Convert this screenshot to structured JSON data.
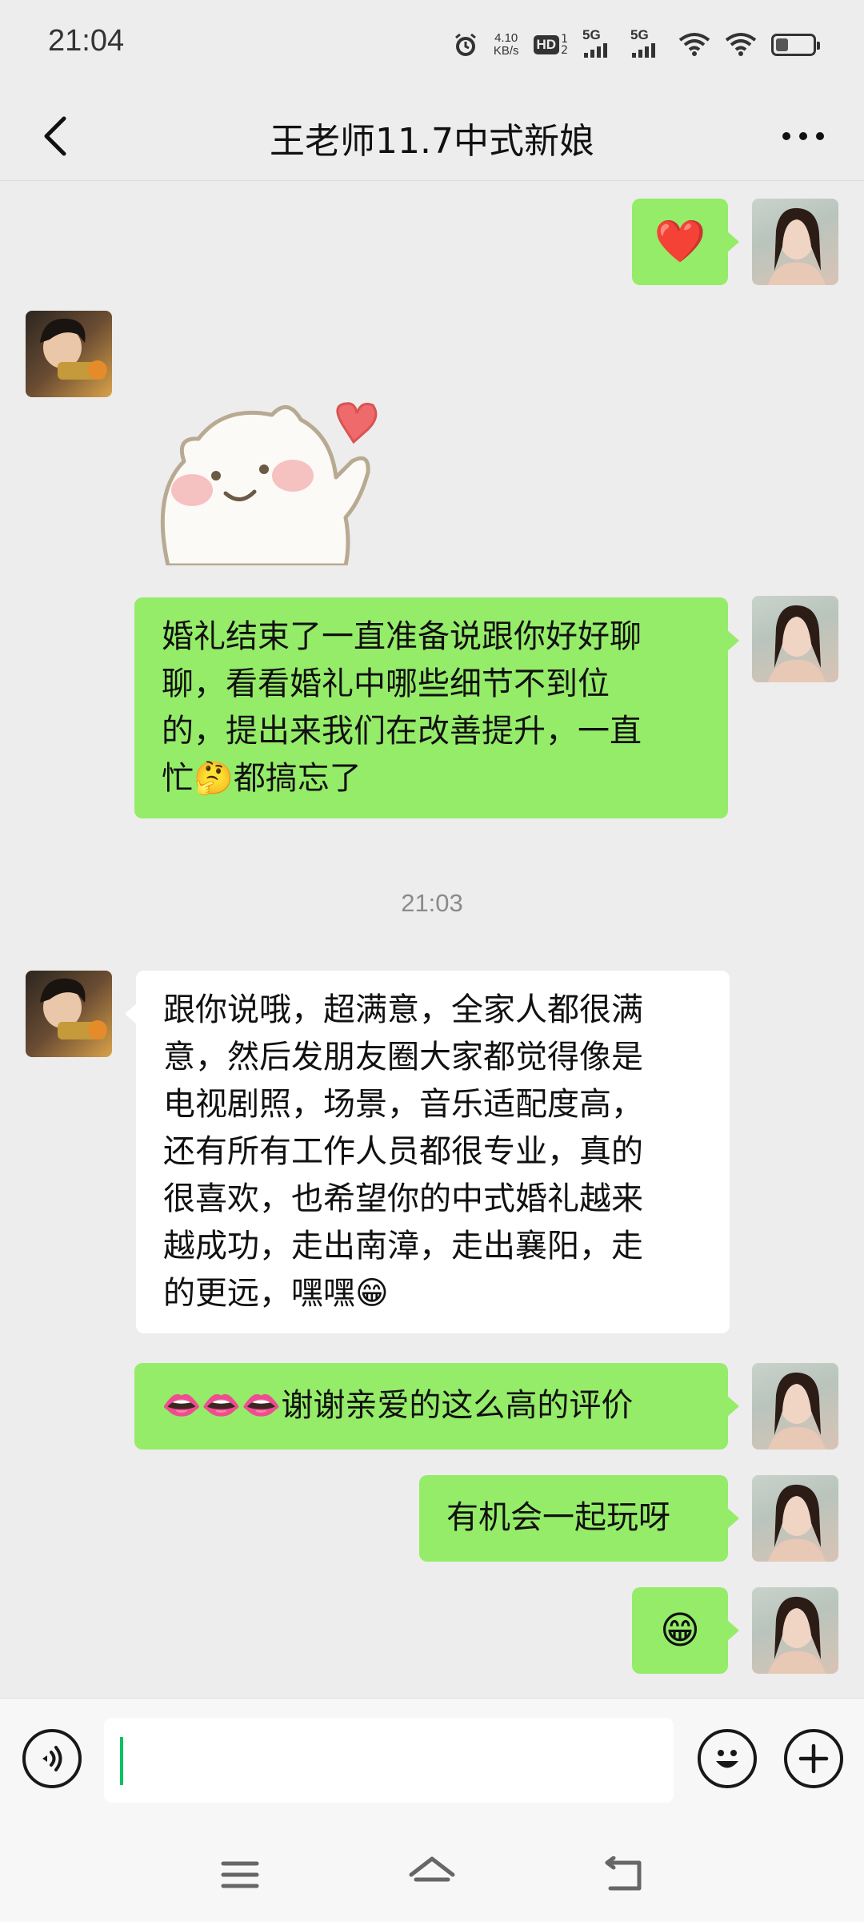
{
  "status_bar": {
    "time": "21:04",
    "net_speed_value": "4.10",
    "net_speed_unit": "KB/s",
    "hd_label": "HD",
    "hd_sub_1": "1",
    "hd_sub_2": "2",
    "signal_1_label": "5G",
    "signal_2_label": "5G",
    "battery_level": 0.35,
    "icons": [
      "alarm-icon",
      "wifi-icon",
      "wifi-icon",
      "battery-icon"
    ]
  },
  "header": {
    "title": "王老师11.7中式新娘",
    "back_icon": "chevron-left-icon",
    "more_icon": "more-horizontal-icon"
  },
  "messages": {
    "m1": {
      "sender": "me",
      "type": "emoji",
      "emoji": "❤️"
    },
    "m2": {
      "sender": "friend",
      "type": "sticker",
      "description_icon": "bear-heart-sticker"
    },
    "m3": {
      "sender": "me",
      "line1": "婚礼结束了一直准备说跟你好好聊",
      "line2": "聊，看看婚礼中哪些细节不到位",
      "line3": "的，提出来我们在改善提升，一直",
      "line4_a": "忙",
      "line4_emoji": "🤔",
      "line4_b": "都搞忘了"
    },
    "timestamp": "21:03",
    "m4": {
      "sender": "friend",
      "line1": "跟你说哦，超满意，全家人都很满",
      "line2": "意，然后发朋友圈大家都觉得像是",
      "line3": "电视剧照，场景，音乐适配度高，",
      "line4": "还有所有工作人员都很专业，真的",
      "line5": "很喜欢，也希望你的中式婚礼越来",
      "line6": "越成功，走出南漳，走出襄阳，走",
      "line7_a": "的更远，嘿嘿",
      "line7_emoji": "😁"
    },
    "m5": {
      "sender": "me",
      "emoji": "👄👄👄",
      "text": "谢谢亲爱的这么高的评价"
    },
    "m6": {
      "sender": "me",
      "text": "有机会一起玩呀"
    },
    "m7": {
      "sender": "me",
      "type": "emoji",
      "emoji": "😁"
    }
  },
  "input_bar": {
    "value": "",
    "voice_icon": "voice-icon",
    "emoji_icon": "smiley-icon",
    "plus_icon": "plus-icon"
  },
  "system_nav": {
    "icons": [
      "menu-icon",
      "home-icon",
      "back-icon"
    ]
  },
  "colors": {
    "my_bubble": "#95ec69",
    "their_bubble": "#ffffff",
    "background": "#ededed",
    "caret": "#07c160"
  }
}
